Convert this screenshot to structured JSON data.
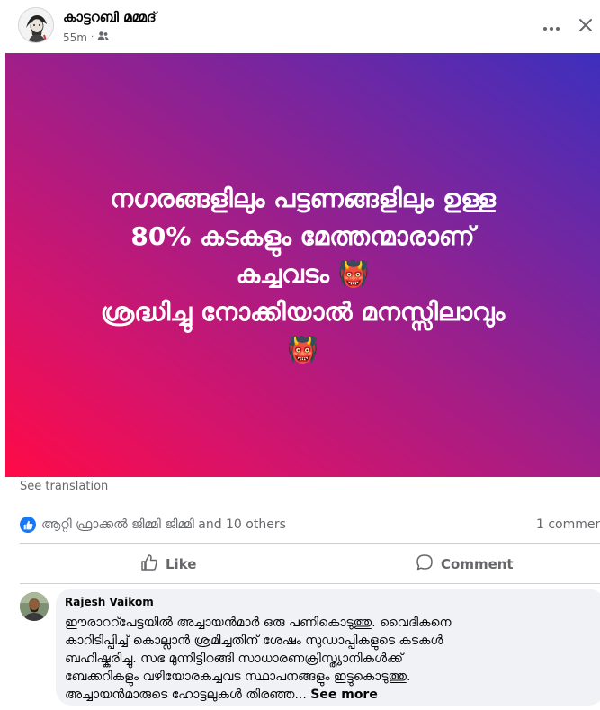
{
  "post": {
    "author": "കാട്ടറബി മമ്മദ്",
    "time": "55m",
    "separator": "·",
    "icons": {
      "audience": "friends-icon",
      "more": "more-horizontal-icon",
      "close": "close-icon"
    },
    "image_text_lines": [
      "നഗരങ്ങളിലും പട്ടണങ്ങളിലും ഉള്ള",
      "80% കടകളും മേത്തന്മാരാണ്",
      "കച്ചവടം 👹",
      "ശ്രദ്ധിച്ചു നോക്കിയാൽ മനസ്സിലാവും",
      "👹"
    ],
    "colors": {
      "gradient_start": "#ff0a46",
      "gradient_mid": "#a11e88",
      "gradient_end": "#3d2fbd",
      "text": "#ffffff"
    }
  },
  "see_translation": "See translation",
  "reactions": {
    "icon": "like-reaction-icon",
    "text": "ആറ്റി ഫ്രാക്കൽ ജിമ്മി ജിമ്മി and 10 others",
    "comments_count": "1 comment",
    "accent": "#1877f2"
  },
  "actions": {
    "like_label": "Like",
    "comment_label": "Comment"
  },
  "comment": {
    "author": "Rajesh Vaikom",
    "text_lines": [
      "ഈരാററ്പേട്ടയിൽ അച്ചായൻമാർ ഒരു പണികൊടുത്തു. വൈദികനെ",
      "കാറിടിപ്പിച്ച് കൊല്ലാൻ ശ്രമിച്ചതിന് ശേഷം സുഡാപ്പികളുടെ കടകൾ",
      "ബഹിഷ്കരിച്ചു. സഭ മുന്നിട്ടിറങ്ങി സാധാരണക്രിസ്ത്യാനികൾക്ക്",
      "ബേക്കറികളും വഴിയോരകച്ചവട സ്ഥാപനങ്ങളും ഇട്ടുകൊടുത്തു.",
      "അച്ചായൻമാരുടെ ഹോട്ടലുകൾ തിരഞ്ഞ..."
    ],
    "see_more": "See more"
  }
}
